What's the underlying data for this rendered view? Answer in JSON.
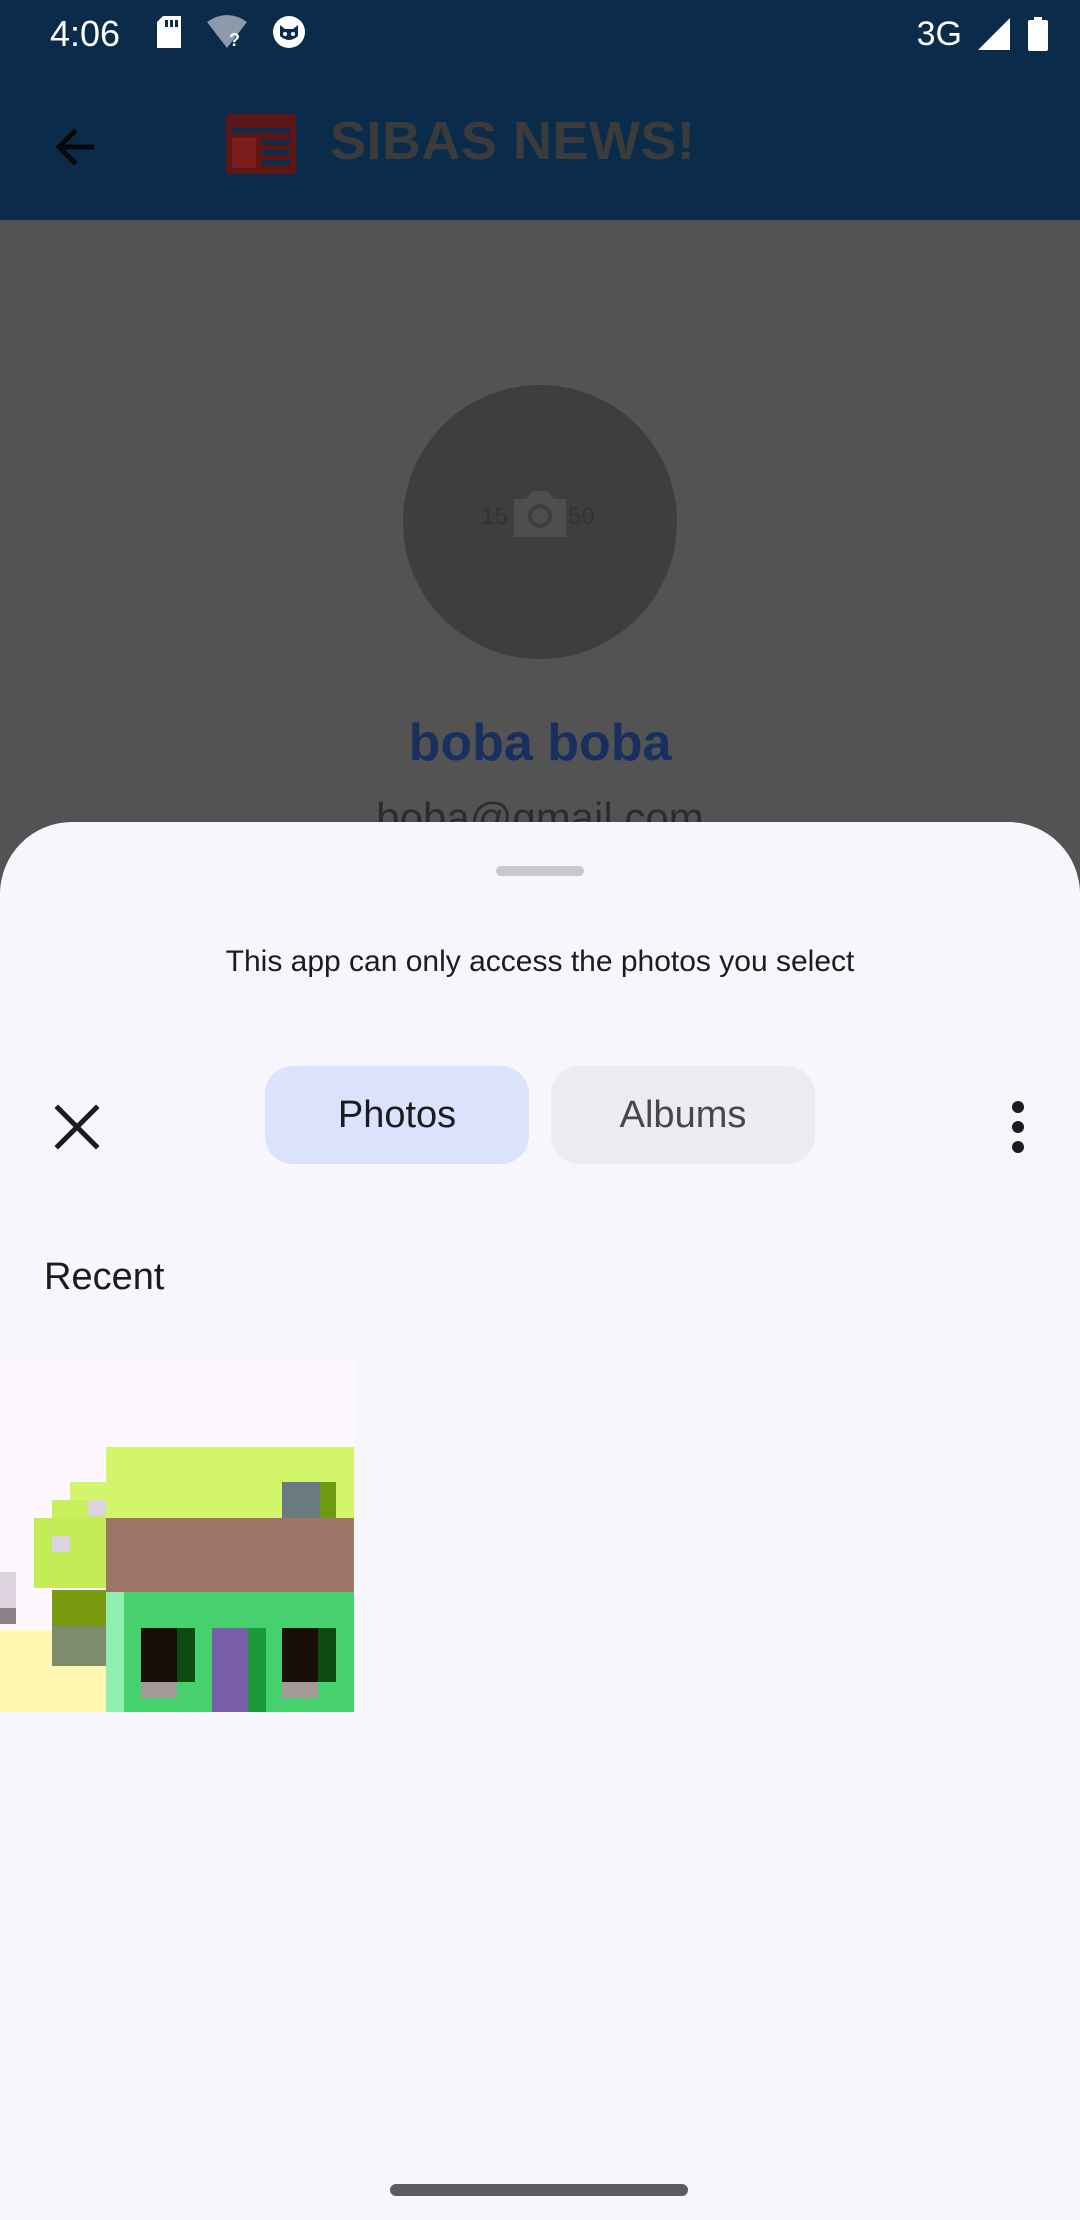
{
  "status_bar": {
    "time": "4:06",
    "network": "3G"
  },
  "app_bar": {
    "title": "SIBAS NEWS!",
    "back_icon": "arrow-back-icon",
    "logo_icon": "newspaper-icon"
  },
  "profile": {
    "avatar_width_label": "15",
    "avatar_height_label": "50",
    "name": "boba boba",
    "email": "boba@gmail.com"
  },
  "photo_picker": {
    "info_text": "This app can only access the photos you select",
    "tabs": [
      {
        "label": "Photos",
        "selected": true
      },
      {
        "label": "Albums",
        "selected": false
      }
    ],
    "section_title": "Recent"
  },
  "colors": {
    "app_bar": "#0b2b4a",
    "sheet_background": "#f7f6fc",
    "tab_selected": "#dbe2fc",
    "tab_unselected": "#ecebf1",
    "profile_name": "#17305e"
  }
}
